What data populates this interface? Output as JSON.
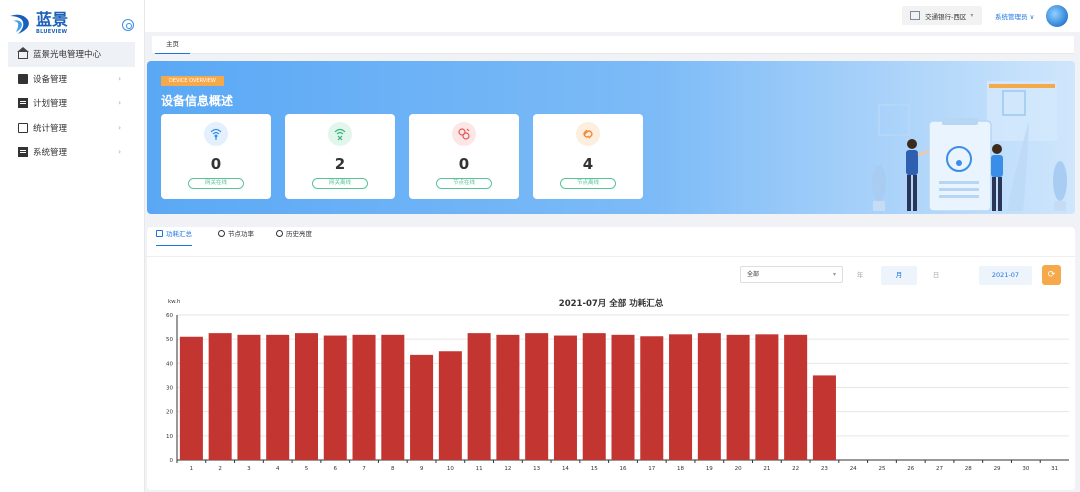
{
  "brand": {
    "name": "蓝景",
    "sub": "BLUEVIEW"
  },
  "sidebar": {
    "items": [
      {
        "label": "蓝景光电管理中心",
        "icon": "home-icon",
        "active": true
      },
      {
        "label": "设备管理",
        "icon": "book-icon",
        "chevron": "›"
      },
      {
        "label": "计划管理",
        "icon": "list-icon",
        "chevron": "›"
      },
      {
        "label": "统计管理",
        "icon": "clipboard-icon",
        "chevron": "›"
      },
      {
        "label": "系统管理",
        "icon": "list-icon",
        "chevron": "›"
      }
    ]
  },
  "header": {
    "bank": "交通银行-西区",
    "admin": "系统管理员 ∨"
  },
  "tabs": {
    "home": "主页"
  },
  "overview": {
    "badge": "DEVICE OVERVIEW",
    "title": "设备信息概述",
    "stats": [
      {
        "value": "0",
        "label": "网关在线",
        "icon": "gateway-online-icon",
        "color": "#3b8ee8",
        "bg": "#e4f0fd"
      },
      {
        "value": "2",
        "label": "网关离线",
        "icon": "gateway-offline-icon",
        "color": "#2fb67a",
        "bg": "#e2f6ec"
      },
      {
        "value": "0",
        "label": "节点在线",
        "icon": "node-online-icon",
        "color": "#e05a5a",
        "bg": "#fde6e6"
      },
      {
        "value": "4",
        "label": "节点离线",
        "icon": "node-offline-icon",
        "color": "#f08a3a",
        "bg": "#fdeede"
      }
    ]
  },
  "panel": {
    "tabs": [
      "功耗汇总",
      "节点功率",
      "历史亮度"
    ],
    "filter": {
      "value": "全部",
      "caret": "▾"
    },
    "year_label": "年",
    "month_label": "月",
    "day_label": "日",
    "date": "2021-07",
    "refresh": "⟳"
  },
  "colors": {
    "accent": "#1b74e4",
    "bar": "#c23531",
    "orange": "#f6a94a"
  },
  "chart_data": {
    "type": "bar",
    "title": "2021-07月 全部 功耗汇总",
    "ylabel": "kw.h",
    "ylim": [
      0,
      60
    ],
    "yticks": [
      0,
      10,
      20,
      30,
      40,
      50,
      60
    ],
    "categories": [
      "1",
      "2",
      "3",
      "4",
      "5",
      "6",
      "7",
      "8",
      "9",
      "10",
      "11",
      "12",
      "13",
      "14",
      "15",
      "16",
      "17",
      "18",
      "19",
      "20",
      "21",
      "22",
      "23",
      "24",
      "25",
      "26",
      "27",
      "28",
      "29",
      "30",
      "31"
    ],
    "values": [
      51,
      52.5,
      51.8,
      51.8,
      52.5,
      51.5,
      51.8,
      51.8,
      43.5,
      45,
      52.5,
      51.8,
      52.5,
      51.5,
      52.5,
      51.8,
      51.2,
      52,
      52.5,
      51.8,
      52,
      51.8,
      35,
      null,
      null,
      null,
      null,
      null,
      null,
      null,
      null
    ],
    "grid": true,
    "legend": "none"
  }
}
